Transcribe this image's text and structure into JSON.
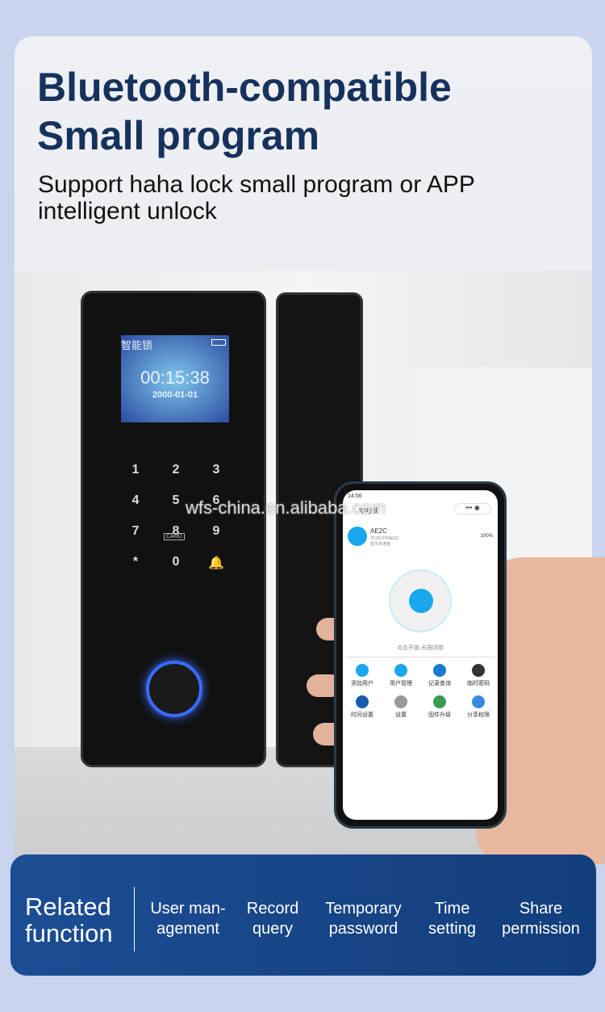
{
  "heading": {
    "title_line1": "Bluetooth-compatible",
    "title_line2": "Small program",
    "subtitle_line1": "Support haha lock small program or APP",
    "subtitle_line2": "intelligent unlock"
  },
  "lock_display": {
    "label": "智能锁",
    "time": "00:15:38",
    "date": "2000-01-01"
  },
  "keypad": [
    "1",
    "2",
    "3",
    "4",
    "5",
    "6",
    "7",
    "8",
    "9",
    "*",
    "0",
    "bell-icon"
  ],
  "card_label": "CARD",
  "watermark": "wfs-china.en.alibaba.com",
  "phone": {
    "status_time": "14:56",
    "app_title": "哈哈锁",
    "device_name": "AE2C",
    "device_id": "7F39197FAE2C",
    "bt_status": "蓝牙未连接",
    "battery": "100%",
    "unlock_hint": "点击开锁,长按闭锁",
    "menu": [
      "添加用户",
      "用户管理",
      "记录查询",
      "临时密码",
      "时间设置",
      "设置",
      "固件升级",
      "分享权限"
    ],
    "accent": "#1aa7ec"
  },
  "banner": {
    "title_line1": "Related",
    "title_line2": "function",
    "functions": [
      {
        "l1": "User man-",
        "l2": "agement"
      },
      {
        "l1": "Record",
        "l2": "query"
      },
      {
        "l1": "Temporary",
        "l2": "password"
      },
      {
        "l1": "Time",
        "l2": "setting"
      },
      {
        "l1": "Share",
        "l2": "permission"
      }
    ]
  }
}
